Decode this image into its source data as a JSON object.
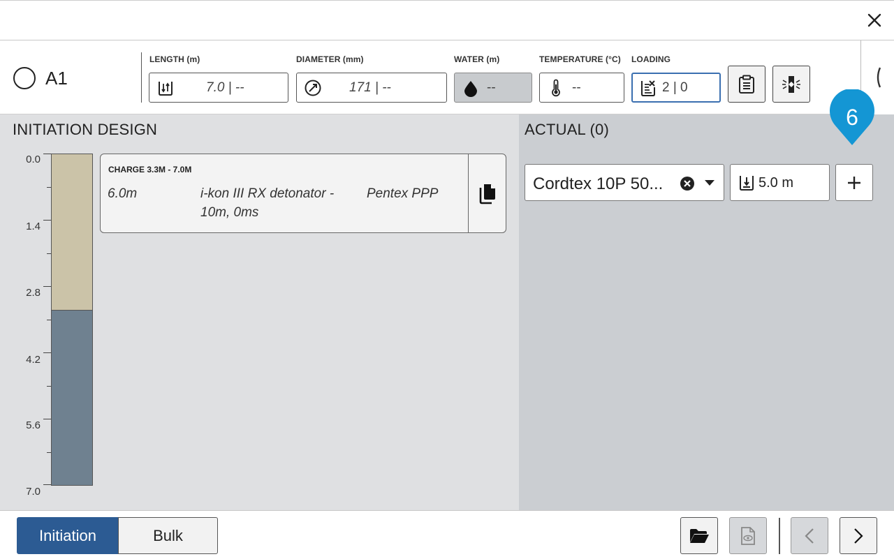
{
  "hole": {
    "name": "A1"
  },
  "fields": {
    "length": {
      "label": "LENGTH (m)",
      "value": "7.0 | --"
    },
    "diameter": {
      "label": "DIAMETER (mm)",
      "value": "171 | --"
    },
    "water": {
      "label": "WATER (m)",
      "value": "--"
    },
    "temperature": {
      "label": "TEMPERATURE (°C)",
      "value": "--"
    },
    "loading": {
      "label": "LOADING",
      "value": "2 | 0"
    }
  },
  "initiation_design": {
    "title": "INITIATION DESIGN",
    "depth_labels": [
      "0.0",
      "1.4",
      "2.8",
      "4.2",
      "5.6",
      "7.0"
    ],
    "column": {
      "max_depth": 7.0,
      "segments": [
        {
          "from": 0.0,
          "to": 3.3,
          "color": "#cbc3a8"
        },
        {
          "from": 3.3,
          "to": 7.0,
          "color": "#6f8190"
        }
      ]
    },
    "charge": {
      "heading": "CHARGE 3.3M - 7.0M",
      "depth": "6.0m",
      "detonator": "i-kon III RX detonator - 10m, 0ms",
      "booster": "Pentex PPP"
    }
  },
  "actual": {
    "title": "ACTUAL (0)",
    "product_select": "Cordtex 10P 50...",
    "length_value": "5.0 m",
    "badge": "6"
  },
  "footer": {
    "tabs": {
      "initiation": "Initiation",
      "bulk": "Bulk"
    }
  },
  "colors": {
    "accent": "#2c5b93",
    "badge": "#1496d4"
  }
}
